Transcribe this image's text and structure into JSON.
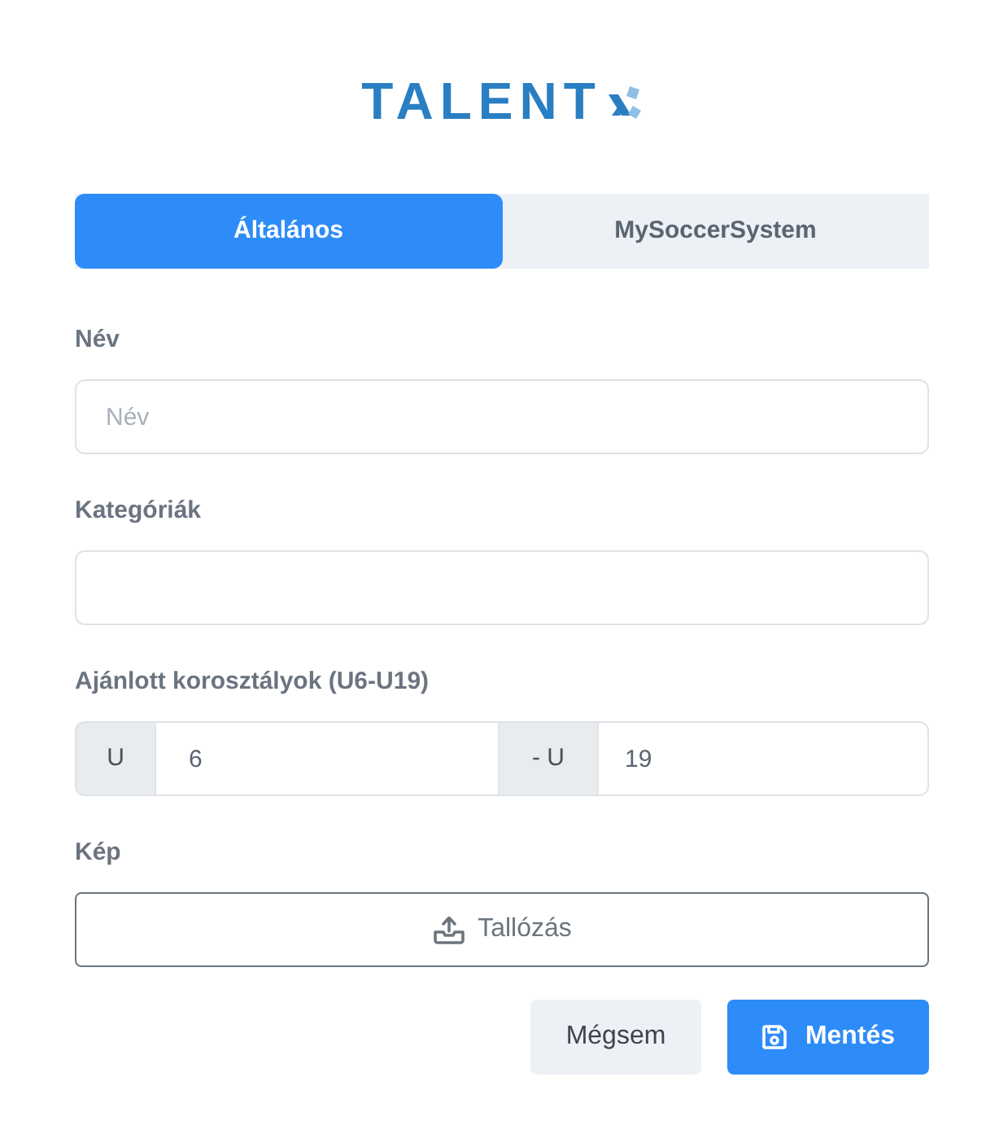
{
  "logo": {
    "text": "TALENT"
  },
  "tabs": [
    {
      "label": "Általános",
      "selected": true
    },
    {
      "label": "MySoccerSystem",
      "selected": false
    }
  ],
  "fields": [
    {
      "kind": "text",
      "label": "Név",
      "placeholder": "Név"
    },
    {
      "kind": "text",
      "label": "Kategóriák"
    },
    {
      "kind": "range",
      "label": "Ajánlott korosztályok (U6-U19)",
      "from_prefix": "U",
      "from_value": "6",
      "to_prefix": "- U",
      "to_value": "19"
    },
    {
      "kind": "file",
      "label": "Kép",
      "button": "Tallózás"
    }
  ],
  "actions": [
    {
      "kind": "secondary",
      "label": "Mégsem"
    },
    {
      "kind": "primary",
      "label": "Mentés"
    }
  ]
}
